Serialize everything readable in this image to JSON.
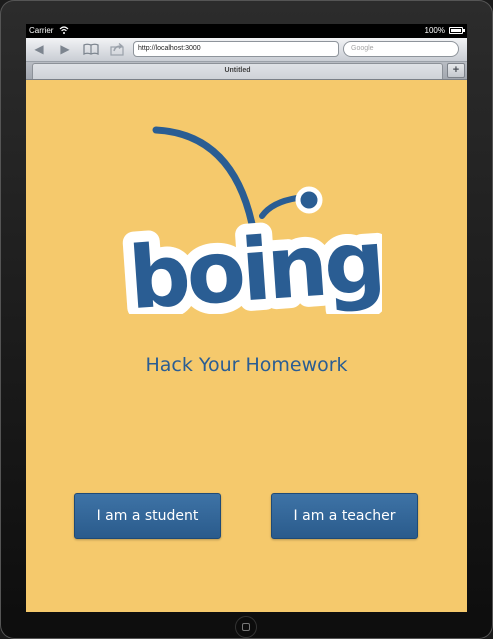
{
  "status_bar": {
    "carrier": "Carrier",
    "battery_percent": "100%"
  },
  "browser": {
    "url": "http://localhost:3000",
    "search_placeholder": "Google",
    "tab_title": "Untitled",
    "new_tab_label": "+",
    "icons": {
      "back": "back-arrow-icon",
      "forward": "forward-arrow-icon",
      "bookmarks": "bookmarks-book-icon",
      "share": "share-icon"
    }
  },
  "page": {
    "logo_text": "boing",
    "tagline": "Hack Your Homework",
    "student_button": "I am a student",
    "teacher_button": "I am a teacher",
    "colors": {
      "background": "#f5c96c",
      "brand_blue": "#2a5d93",
      "button_blue": "#2f649a"
    }
  }
}
